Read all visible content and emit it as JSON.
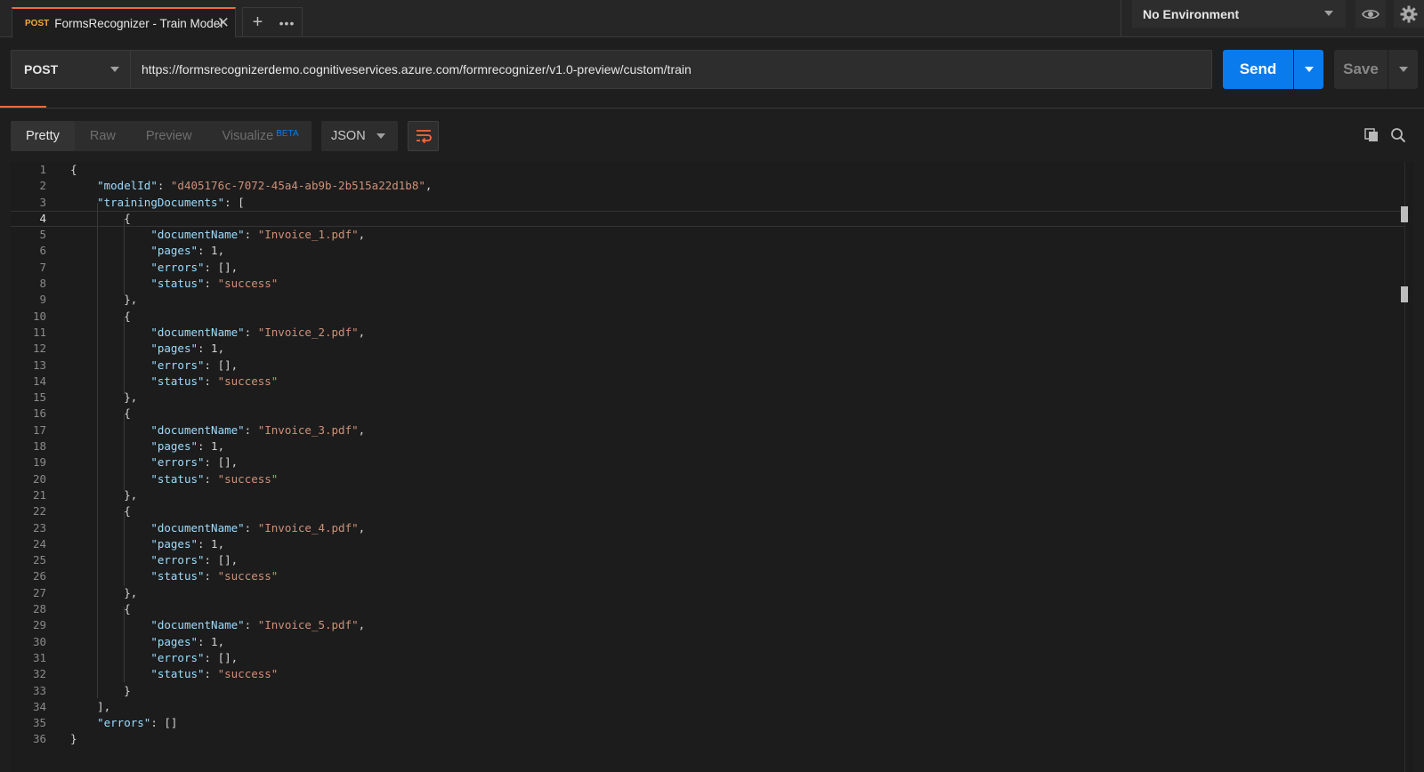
{
  "tab": {
    "method": "POST",
    "title": "FormsRecognizer - Train Model",
    "close": "✕",
    "new_tab": "+",
    "more": "•••"
  },
  "environment": {
    "selected": "No Environment"
  },
  "request": {
    "method": "POST",
    "url": "https://formsrecognizerdemo.cognitiveservices.azure.com/formrecognizer/v1.0-preview/custom/train",
    "send_label": "Send",
    "save_label": "Save"
  },
  "response_toolbar": {
    "tabs": [
      {
        "label": "Pretty",
        "active": true
      },
      {
        "label": "Raw",
        "active": false
      },
      {
        "label": "Preview",
        "active": false
      },
      {
        "label": "Visualize",
        "badge": "BETA",
        "active": false
      }
    ],
    "format": "JSON",
    "icons": [
      "wrap-lines-icon",
      "copy-icon",
      "search-icon"
    ]
  },
  "colors": {
    "accent": "#f26b3a",
    "send": "#097bed",
    "json_key": "#9cdcfe",
    "json_string": "#ce9178"
  },
  "response": {
    "current_line": 4,
    "lines": [
      "{",
      "    \"modelId\": \"d405176c-7072-45a4-ab9b-2b515a22d1b8\",",
      "    \"trainingDocuments\": [",
      "        {",
      "            \"documentName\": \"Invoice_1.pdf\",",
      "            \"pages\": 1,",
      "            \"errors\": [],",
      "            \"status\": \"success\"",
      "        },",
      "        {",
      "            \"documentName\": \"Invoice_2.pdf\",",
      "            \"pages\": 1,",
      "            \"errors\": [],",
      "            \"status\": \"success\"",
      "        },",
      "        {",
      "            \"documentName\": \"Invoice_3.pdf\",",
      "            \"pages\": 1,",
      "            \"errors\": [],",
      "            \"status\": \"success\"",
      "        },",
      "        {",
      "            \"documentName\": \"Invoice_4.pdf\",",
      "            \"pages\": 1,",
      "            \"errors\": [],",
      "            \"status\": \"success\"",
      "        },",
      "        {",
      "            \"documentName\": \"Invoice_5.pdf\",",
      "            \"pages\": 1,",
      "            \"errors\": [],",
      "            \"status\": \"success\"",
      "        }",
      "    ],",
      "    \"errors\": []",
      "}"
    ]
  }
}
